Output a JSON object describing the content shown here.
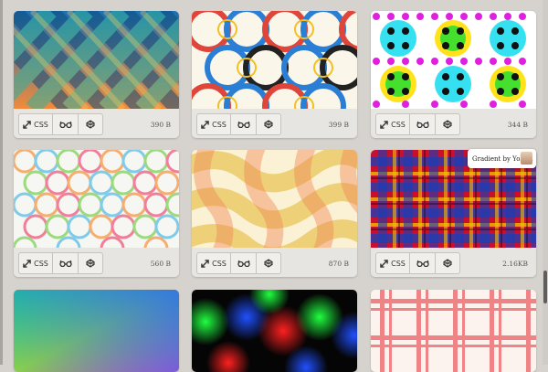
{
  "cards": [
    {
      "css_label": "CSS",
      "size": "390 B"
    },
    {
      "css_label": "CSS",
      "size": "399 B"
    },
    {
      "css_label": "CSS",
      "size": "344 B"
    },
    {
      "css_label": "CSS",
      "size": "560 B"
    },
    {
      "css_label": "CSS",
      "size": "870 B"
    },
    {
      "css_label": "CSS",
      "size": "2.16KB"
    }
  ],
  "tooltip": {
    "text": "Gradient by Yoksel"
  },
  "icons": {
    "css": "css-arrows-icon",
    "glasses": "glasses-icon",
    "codepen": "codepen-icon"
  }
}
